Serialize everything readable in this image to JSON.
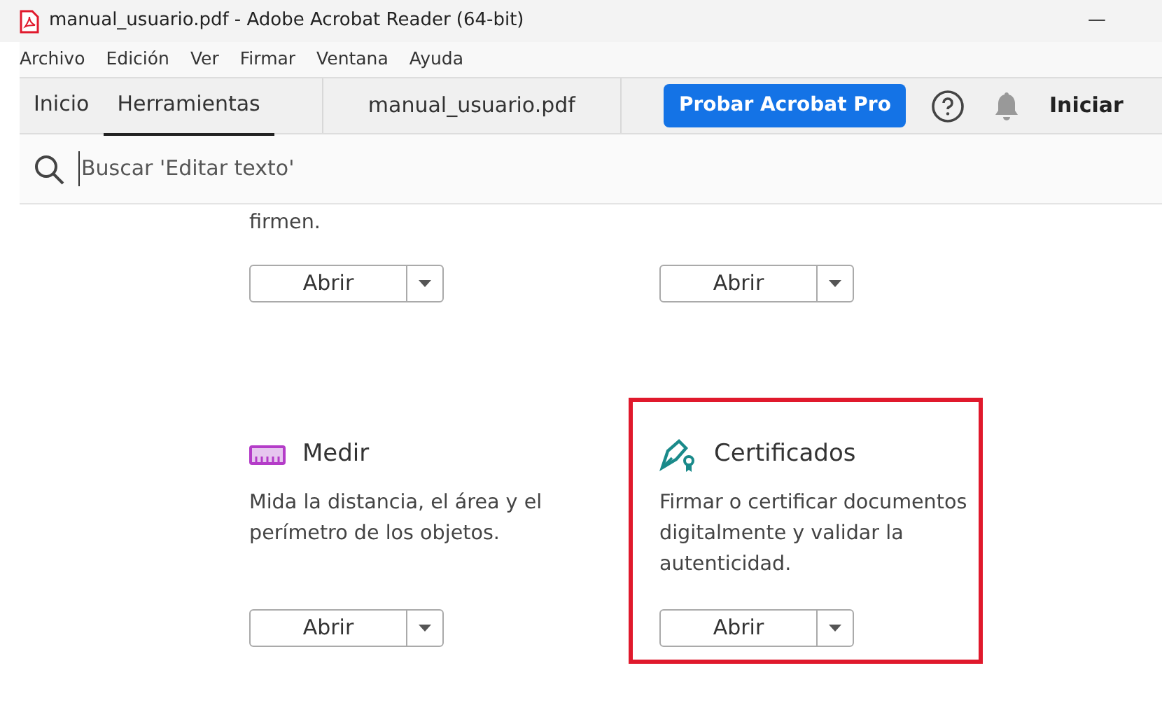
{
  "window": {
    "title": "manual_usuario.pdf - Adobe Acrobat Reader (64-bit)",
    "minimize": "—"
  },
  "menu": [
    "Archivo",
    "Edición",
    "Ver",
    "Firmar",
    "Ventana",
    "Ayuda"
  ],
  "tabs": [
    {
      "label": "Inicio",
      "selected": false
    },
    {
      "label": "Herramientas",
      "selected": true
    }
  ],
  "document_tab": "manual_usuario.pdf",
  "trial_button": "Probar Acrobat Pro",
  "sign_in": "Iniciar",
  "search": {
    "placeholder": "Buscar 'Editar texto'"
  },
  "tools": [
    {
      "kind": "partial",
      "description": "firmen.",
      "button": "Abrir",
      "highlighted": false
    },
    {
      "kind": "partial",
      "button": "Abrir",
      "highlighted": false
    },
    {
      "kind": "measure",
      "name": "Medir",
      "description": "Mida la distancia, el área y el perímetro de los objetos.",
      "button": "Abrir",
      "highlighted": false
    },
    {
      "kind": "certificate",
      "name": "Certificados",
      "description": "Firmar o certificar documentos digitalmente y validar la autenticidad.",
      "button": "Abrir",
      "highlighted": true
    }
  ]
}
